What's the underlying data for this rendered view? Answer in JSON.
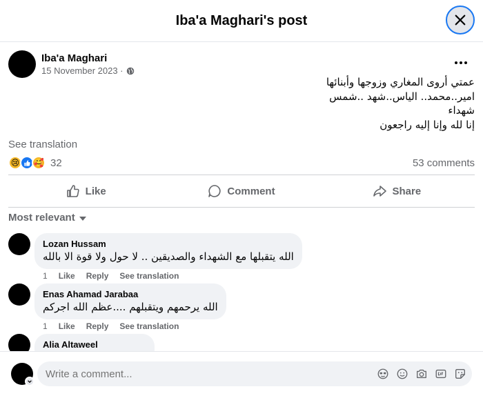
{
  "header": {
    "title": "Iba'a Maghari's post"
  },
  "post": {
    "author": "Iba'a Maghari",
    "date": "15 November 2023 ·",
    "text_lines": [
      "عمتي أروى المغاري وزوجها وأبنائها",
      "امير..محمد.. الياس..شهد ..شمس",
      "شهداء",
      "إنا لله وإنا إليه راجعون"
    ],
    "see_translation": "See translation",
    "reaction_count": "32",
    "comments_count": "53 comments"
  },
  "actions": {
    "like": "Like",
    "comment": "Comment",
    "share": "Share"
  },
  "sort": {
    "label": "Most relevant"
  },
  "comments": [
    {
      "name": "Lozan Hussam",
      "text": "الله يتقبلها مع الشهداء والصديقين .. لا حول ولا قوة الا بالله",
      "time": "1",
      "like": "Like",
      "reply": "Reply",
      "translate": "See translation"
    },
    {
      "name": "Enas Ahamad Jarabaa",
      "text": "الله يرحمهم ويتقبلهم ....عظم الله اجركم",
      "time": "1",
      "like": "Like",
      "reply": "Reply",
      "translate": "See translation"
    },
    {
      "name": "Alia Altaweel"
    }
  ],
  "composer": {
    "placeholder": "Write a comment..."
  },
  "icons": [
    "close-icon",
    "globe-icon",
    "more-icon",
    "sad-reaction-icon",
    "like-reaction-icon",
    "care-reaction-icon",
    "like-icon",
    "comment-icon",
    "share-icon",
    "avatar-sticker-icon",
    "emoji-icon",
    "camera-icon",
    "gif-icon",
    "sticker-icon",
    "chevron-down-icon"
  ],
  "colors": {
    "accent": "#1877f2",
    "muted": "#65676b",
    "bubble": "#f0f2f5"
  }
}
